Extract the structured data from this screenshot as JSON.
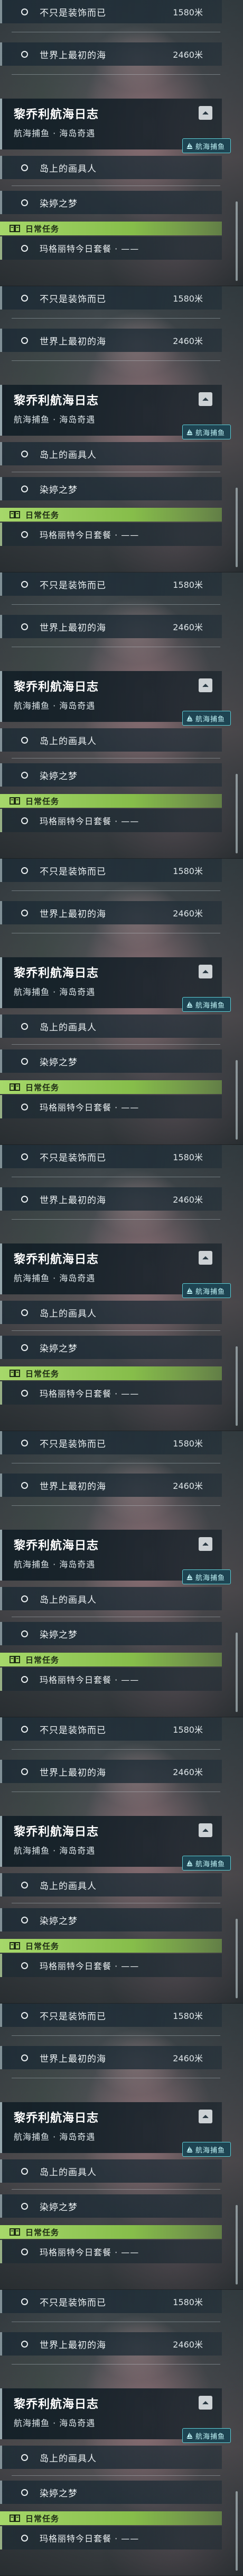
{
  "frame_count": 9,
  "quests": {
    "items": [
      {
        "label": "不只是装饰而已",
        "distance": "1580米"
      },
      {
        "label": "世界上最初的海",
        "distance": "2460米"
      }
    ]
  },
  "current_quest": {
    "title": "黎乔利航海日志",
    "subtitle": "航海捕鱼 · 海岛奇遇",
    "tag": "航海捕鱼",
    "tag_icon": "sailboat-icon",
    "collapse_icon": "chevron-up-icon",
    "steps": [
      {
        "label": "岛上的画具人"
      },
      {
        "label": "染婷之梦"
      }
    ]
  },
  "daily": {
    "label": "日常任务",
    "icon": "book-icon",
    "item": "玛格丽特今日套餐 · ——"
  },
  "colors": {
    "accent_green": "#a6d86a",
    "tag_cyan": "#5fd0d8",
    "panel": "#1e2c36"
  }
}
